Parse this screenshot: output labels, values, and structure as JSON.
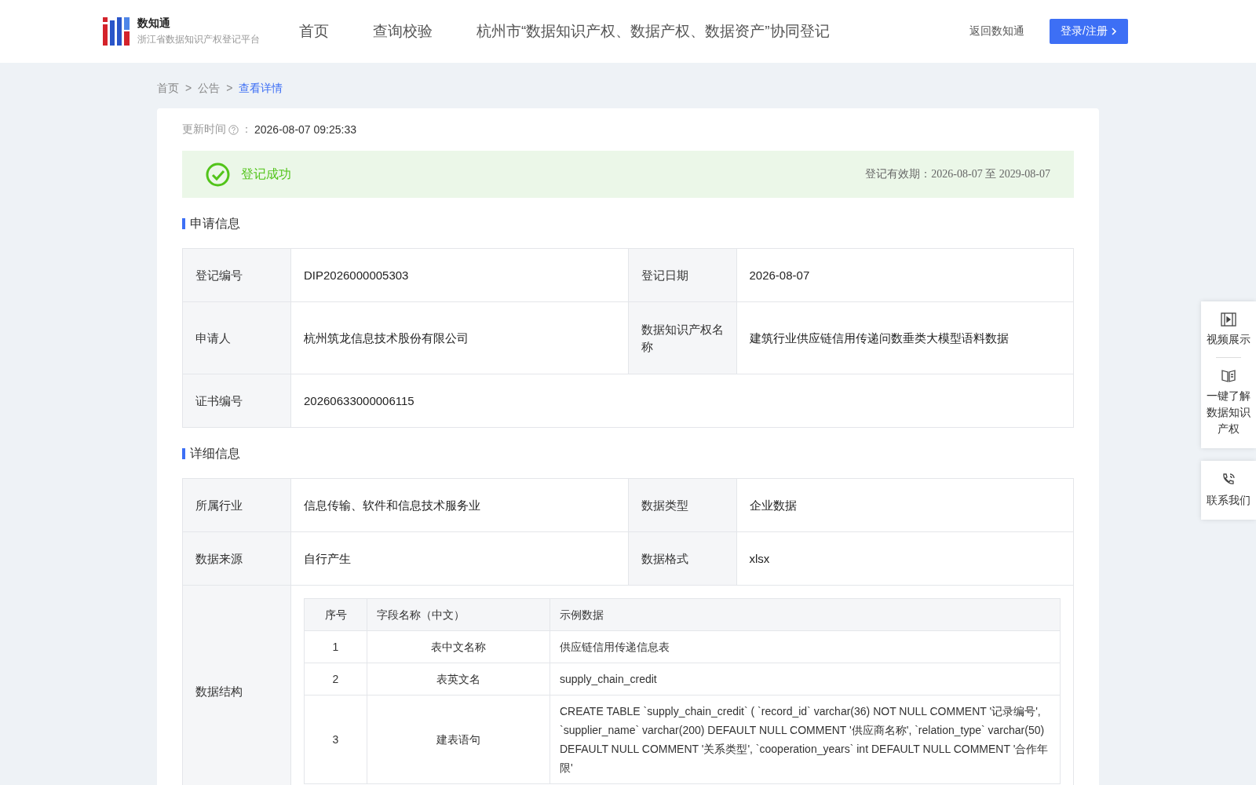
{
  "header": {
    "logo_title": "数知通",
    "logo_subtitle": "浙江省数据知识产权登记平台",
    "nav": [
      {
        "label": "首页",
        "selected": false
      },
      {
        "label": "查询校验",
        "selected": false
      },
      {
        "label": "杭州市“数据知识产权、数据产权、数据资产”协同登记",
        "selected": false
      }
    ],
    "back_link": "返回数知通",
    "login_button": "登录/注册"
  },
  "breadcrumb": [
    {
      "label": "首页",
      "selected": false
    },
    {
      "label": "公告",
      "selected": false
    },
    {
      "label": "查看详情",
      "selected": true
    }
  ],
  "breadcrumb_separator": ">",
  "update_time": {
    "label": "更新时间",
    "colon": "：",
    "value": "2026-08-07 09:25:33"
  },
  "status": {
    "text": "登记成功",
    "validity": "登记有效期：2026-08-07 至 2029-08-07"
  },
  "application_info": {
    "title": "申请信息",
    "rows": [
      {
        "cells": [
          {
            "label": "登记编号",
            "value": "DIP2026000005303"
          },
          {
            "label": "登记日期",
            "value": "2026-08-07"
          }
        ]
      },
      {
        "cells": [
          {
            "label": "申请人",
            "value": "杭州筑龙信息技术股份有限公司"
          },
          {
            "label": "数据知识产权名称",
            "value": "建筑行业供应链信用传递问数垂类大模型语料数据"
          }
        ]
      },
      {
        "cells": [
          {
            "label": "证书编号",
            "value": "20260633000006115"
          }
        ]
      }
    ]
  },
  "detail_info": {
    "title": "详细信息",
    "rows": [
      {
        "cells": [
          {
            "label": "所属行业",
            "value": "信息传输、软件和信息技术服务业"
          },
          {
            "label": "数据类型",
            "value": "企业数据"
          }
        ]
      },
      {
        "cells": [
          {
            "label": "数据来源",
            "value": "自行产生"
          },
          {
            "label": "数据格式",
            "value": "xlsx"
          }
        ]
      }
    ],
    "structure": {
      "label": "数据结构",
      "columns": [
        "序号",
        "字段名称（中文）",
        "示例数据"
      ],
      "rows": [
        [
          "1",
          "表中文名称",
          "供应链信用传递信息表"
        ],
        [
          "2",
          "表英文名",
          "supply_chain_credit"
        ],
        [
          "3",
          "建表语句",
          "CREATE TABLE `supply_chain_credit` ( `record_id` varchar(36) NOT NULL COMMENT '记录编号', `supplier_name` varchar(200) DEFAULT NULL COMMENT '供应商名称', `relation_type` varchar(50) DEFAULT NULL COMMENT '关系类型', `cooperation_years` int DEFAULT NULL COMMENT '合作年限'"
        ]
      ]
    }
  },
  "side_panel": [
    {
      "kind": "video",
      "label": "视频展示"
    },
    {
      "kind": "book",
      "label": "一键了解数据知识产权"
    },
    {
      "kind": "phone",
      "label": "联系我们"
    }
  ]
}
